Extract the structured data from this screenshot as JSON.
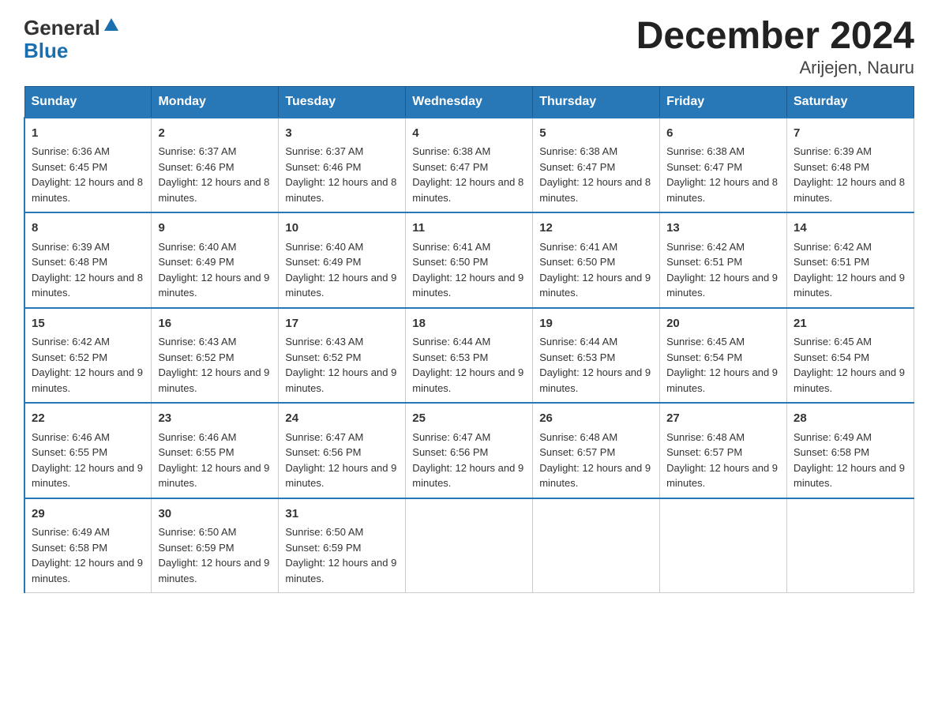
{
  "logo": {
    "top": "General",
    "bottom": "Blue"
  },
  "title": "December 2024",
  "subtitle": "Arijejen, Nauru",
  "days_of_week": [
    "Sunday",
    "Monday",
    "Tuesday",
    "Wednesday",
    "Thursday",
    "Friday",
    "Saturday"
  ],
  "weeks": [
    [
      {
        "day": "1",
        "sunrise": "6:36 AM",
        "sunset": "6:45 PM",
        "daylight": "12 hours and 8 minutes."
      },
      {
        "day": "2",
        "sunrise": "6:37 AM",
        "sunset": "6:46 PM",
        "daylight": "12 hours and 8 minutes."
      },
      {
        "day": "3",
        "sunrise": "6:37 AM",
        "sunset": "6:46 PM",
        "daylight": "12 hours and 8 minutes."
      },
      {
        "day": "4",
        "sunrise": "6:38 AM",
        "sunset": "6:47 PM",
        "daylight": "12 hours and 8 minutes."
      },
      {
        "day": "5",
        "sunrise": "6:38 AM",
        "sunset": "6:47 PM",
        "daylight": "12 hours and 8 minutes."
      },
      {
        "day": "6",
        "sunrise": "6:38 AM",
        "sunset": "6:47 PM",
        "daylight": "12 hours and 8 minutes."
      },
      {
        "day": "7",
        "sunrise": "6:39 AM",
        "sunset": "6:48 PM",
        "daylight": "12 hours and 8 minutes."
      }
    ],
    [
      {
        "day": "8",
        "sunrise": "6:39 AM",
        "sunset": "6:48 PM",
        "daylight": "12 hours and 8 minutes."
      },
      {
        "day": "9",
        "sunrise": "6:40 AM",
        "sunset": "6:49 PM",
        "daylight": "12 hours and 9 minutes."
      },
      {
        "day": "10",
        "sunrise": "6:40 AM",
        "sunset": "6:49 PM",
        "daylight": "12 hours and 9 minutes."
      },
      {
        "day": "11",
        "sunrise": "6:41 AM",
        "sunset": "6:50 PM",
        "daylight": "12 hours and 9 minutes."
      },
      {
        "day": "12",
        "sunrise": "6:41 AM",
        "sunset": "6:50 PM",
        "daylight": "12 hours and 9 minutes."
      },
      {
        "day": "13",
        "sunrise": "6:42 AM",
        "sunset": "6:51 PM",
        "daylight": "12 hours and 9 minutes."
      },
      {
        "day": "14",
        "sunrise": "6:42 AM",
        "sunset": "6:51 PM",
        "daylight": "12 hours and 9 minutes."
      }
    ],
    [
      {
        "day": "15",
        "sunrise": "6:42 AM",
        "sunset": "6:52 PM",
        "daylight": "12 hours and 9 minutes."
      },
      {
        "day": "16",
        "sunrise": "6:43 AM",
        "sunset": "6:52 PM",
        "daylight": "12 hours and 9 minutes."
      },
      {
        "day": "17",
        "sunrise": "6:43 AM",
        "sunset": "6:52 PM",
        "daylight": "12 hours and 9 minutes."
      },
      {
        "day": "18",
        "sunrise": "6:44 AM",
        "sunset": "6:53 PM",
        "daylight": "12 hours and 9 minutes."
      },
      {
        "day": "19",
        "sunrise": "6:44 AM",
        "sunset": "6:53 PM",
        "daylight": "12 hours and 9 minutes."
      },
      {
        "day": "20",
        "sunrise": "6:45 AM",
        "sunset": "6:54 PM",
        "daylight": "12 hours and 9 minutes."
      },
      {
        "day": "21",
        "sunrise": "6:45 AM",
        "sunset": "6:54 PM",
        "daylight": "12 hours and 9 minutes."
      }
    ],
    [
      {
        "day": "22",
        "sunrise": "6:46 AM",
        "sunset": "6:55 PM",
        "daylight": "12 hours and 9 minutes."
      },
      {
        "day": "23",
        "sunrise": "6:46 AM",
        "sunset": "6:55 PM",
        "daylight": "12 hours and 9 minutes."
      },
      {
        "day": "24",
        "sunrise": "6:47 AM",
        "sunset": "6:56 PM",
        "daylight": "12 hours and 9 minutes."
      },
      {
        "day": "25",
        "sunrise": "6:47 AM",
        "sunset": "6:56 PM",
        "daylight": "12 hours and 9 minutes."
      },
      {
        "day": "26",
        "sunrise": "6:48 AM",
        "sunset": "6:57 PM",
        "daylight": "12 hours and 9 minutes."
      },
      {
        "day": "27",
        "sunrise": "6:48 AM",
        "sunset": "6:57 PM",
        "daylight": "12 hours and 9 minutes."
      },
      {
        "day": "28",
        "sunrise": "6:49 AM",
        "sunset": "6:58 PM",
        "daylight": "12 hours and 9 minutes."
      }
    ],
    [
      {
        "day": "29",
        "sunrise": "6:49 AM",
        "sunset": "6:58 PM",
        "daylight": "12 hours and 9 minutes."
      },
      {
        "day": "30",
        "sunrise": "6:50 AM",
        "sunset": "6:59 PM",
        "daylight": "12 hours and 9 minutes."
      },
      {
        "day": "31",
        "sunrise": "6:50 AM",
        "sunset": "6:59 PM",
        "daylight": "12 hours and 9 minutes."
      },
      null,
      null,
      null,
      null
    ]
  ],
  "labels": {
    "sunrise": "Sunrise:",
    "sunset": "Sunset:",
    "daylight": "Daylight:"
  }
}
